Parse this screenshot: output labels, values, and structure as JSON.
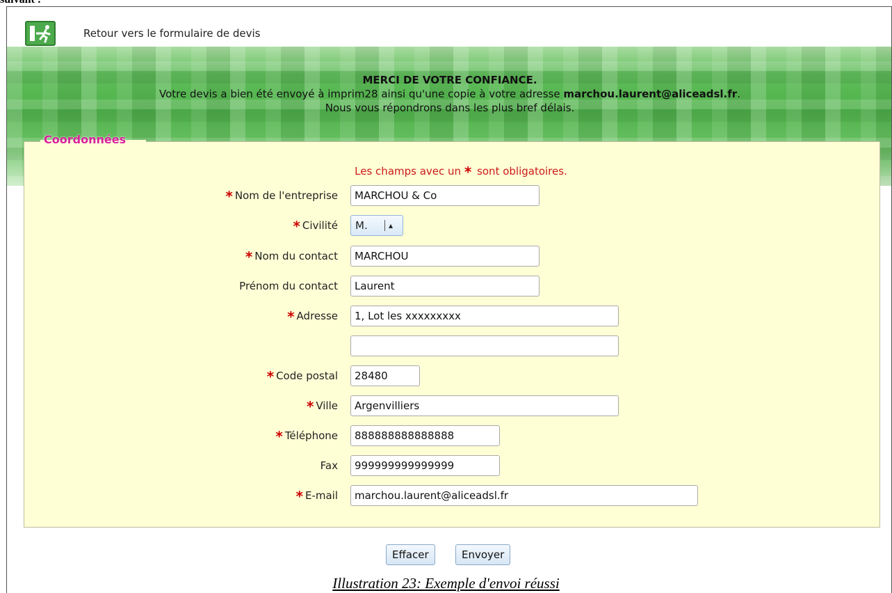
{
  "doc": {
    "top_text": "suivant :",
    "caption": "Illustration 23: Exemple d'envoi réussi"
  },
  "nav": {
    "back_link": "Retour vers le formulaire de devis",
    "icon": "exit-icon"
  },
  "banner": {
    "title": "MERCI DE VOTRE CONFIANCE.",
    "line2_prefix": "Votre devis a bien été envoyé  à imprim28 ainsi qu'une copie à votre adresse ",
    "line2_email": "marchou.laurent@aliceadsl.fr",
    "line2_suffix": ".",
    "line3": "Nous vous répondrons dans les plus bref délais."
  },
  "form": {
    "legend": "Coordonnées",
    "required_note_prefix": "Les champs avec un ",
    "required_note_suffix": " sont obligatoires.",
    "star": "*",
    "fields": {
      "entreprise": {
        "label": "Nom de l'entreprise",
        "value": "MARCHOU & Co"
      },
      "civilite": {
        "label": "Civilité",
        "value": "M."
      },
      "contact": {
        "label": "Nom du contact",
        "value": "MARCHOU"
      },
      "prenom": {
        "label": "Prénom du contact",
        "value": "Laurent"
      },
      "adresse": {
        "label": "Adresse",
        "value": "1, Lot les xxxxxxxxx"
      },
      "adresse2": {
        "label": "",
        "value": ""
      },
      "code_postal": {
        "label": "Code postal",
        "value": "28480"
      },
      "ville": {
        "label": "Ville",
        "value": "Argenvilliers"
      },
      "telephone": {
        "label": "Téléphone",
        "value": "888888888888888"
      },
      "fax": {
        "label": "Fax",
        "value": "999999999999999"
      },
      "email": {
        "label": "E-mail",
        "value": "marchou.laurent@aliceadsl.fr"
      }
    }
  },
  "buttons": {
    "clear": "Effacer",
    "send": "Envoyer"
  },
  "colors": {
    "legend": "#d9219a",
    "required": "#cc0000",
    "panel": "#ffffd6",
    "banner_green": "#4fb24a"
  }
}
